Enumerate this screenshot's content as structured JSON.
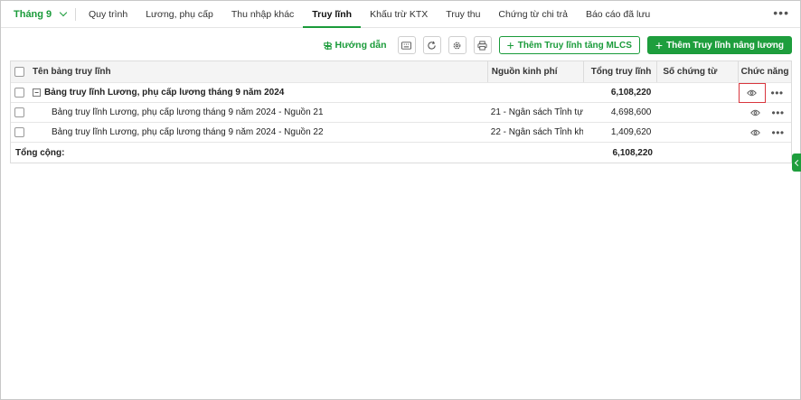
{
  "nav": {
    "month": "Tháng 9",
    "tabs": [
      {
        "label": "Quy trình"
      },
      {
        "label": "Lương, phụ cấp"
      },
      {
        "label": "Thu nhập khác"
      },
      {
        "label": "Truy lĩnh"
      },
      {
        "label": "Khấu trừ KTX"
      },
      {
        "label": "Truy thu"
      },
      {
        "label": "Chứng từ chi trả"
      },
      {
        "label": "Báo cáo đã lưu"
      }
    ],
    "active_tab": "Truy lĩnh",
    "more_icon": "more-horizontal-icon"
  },
  "toolbar": {
    "guide_label": "Hướng dẫn",
    "add_mlcs_label": "Thêm Truy lĩnh tăng MLCS",
    "add_salary_label": "Thêm Truy lĩnh nâng lương"
  },
  "table": {
    "headers": {
      "name": "Tên bảng truy lĩnh",
      "source": "Nguồn kinh phí",
      "total": "Tổng truy lĩnh",
      "doc": "Số chứng từ",
      "actions": "Chức năng"
    },
    "rows": [
      {
        "name": "Bảng truy lĩnh Lương, phụ cấp lương tháng 9 năm 2024",
        "source": "",
        "total": "6,108,220",
        "doc": ""
      },
      {
        "name": "Bảng truy lĩnh Lương, phụ cấp lương tháng 9 năm 2024 - Nguồn 21",
        "source": "21 - Ngân sách Tỉnh tự ...",
        "total": "4,698,600",
        "doc": ""
      },
      {
        "name": "Bảng truy lĩnh Lương, phụ cấp lương tháng 9 năm 2024 - Nguồn 22",
        "source": "22 - Ngân sách Tỉnh kh...",
        "total": "1,409,620",
        "doc": ""
      }
    ],
    "footer": {
      "label": "Tổng cộng:",
      "total": "6,108,220"
    }
  },
  "colors": {
    "accent": "#1e9e3d",
    "highlight": "#d9363e"
  }
}
